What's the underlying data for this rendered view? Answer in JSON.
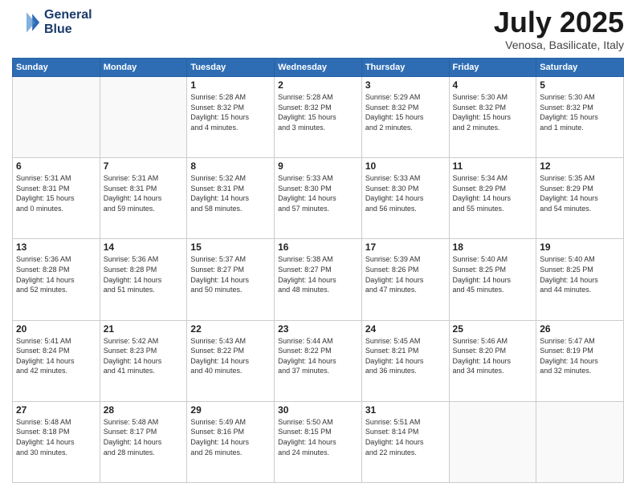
{
  "header": {
    "logo_line1": "General",
    "logo_line2": "Blue",
    "month": "July 2025",
    "location": "Venosa, Basilicate, Italy"
  },
  "weekdays": [
    "Sunday",
    "Monday",
    "Tuesday",
    "Wednesday",
    "Thursday",
    "Friday",
    "Saturday"
  ],
  "weeks": [
    [
      {
        "day": "",
        "text": ""
      },
      {
        "day": "",
        "text": ""
      },
      {
        "day": "1",
        "text": "Sunrise: 5:28 AM\nSunset: 8:32 PM\nDaylight: 15 hours\nand 4 minutes."
      },
      {
        "day": "2",
        "text": "Sunrise: 5:28 AM\nSunset: 8:32 PM\nDaylight: 15 hours\nand 3 minutes."
      },
      {
        "day": "3",
        "text": "Sunrise: 5:29 AM\nSunset: 8:32 PM\nDaylight: 15 hours\nand 2 minutes."
      },
      {
        "day": "4",
        "text": "Sunrise: 5:30 AM\nSunset: 8:32 PM\nDaylight: 15 hours\nand 2 minutes."
      },
      {
        "day": "5",
        "text": "Sunrise: 5:30 AM\nSunset: 8:32 PM\nDaylight: 15 hours\nand 1 minute."
      }
    ],
    [
      {
        "day": "6",
        "text": "Sunrise: 5:31 AM\nSunset: 8:31 PM\nDaylight: 15 hours\nand 0 minutes."
      },
      {
        "day": "7",
        "text": "Sunrise: 5:31 AM\nSunset: 8:31 PM\nDaylight: 14 hours\nand 59 minutes."
      },
      {
        "day": "8",
        "text": "Sunrise: 5:32 AM\nSunset: 8:31 PM\nDaylight: 14 hours\nand 58 minutes."
      },
      {
        "day": "9",
        "text": "Sunrise: 5:33 AM\nSunset: 8:30 PM\nDaylight: 14 hours\nand 57 minutes."
      },
      {
        "day": "10",
        "text": "Sunrise: 5:33 AM\nSunset: 8:30 PM\nDaylight: 14 hours\nand 56 minutes."
      },
      {
        "day": "11",
        "text": "Sunrise: 5:34 AM\nSunset: 8:29 PM\nDaylight: 14 hours\nand 55 minutes."
      },
      {
        "day": "12",
        "text": "Sunrise: 5:35 AM\nSunset: 8:29 PM\nDaylight: 14 hours\nand 54 minutes."
      }
    ],
    [
      {
        "day": "13",
        "text": "Sunrise: 5:36 AM\nSunset: 8:28 PM\nDaylight: 14 hours\nand 52 minutes."
      },
      {
        "day": "14",
        "text": "Sunrise: 5:36 AM\nSunset: 8:28 PM\nDaylight: 14 hours\nand 51 minutes."
      },
      {
        "day": "15",
        "text": "Sunrise: 5:37 AM\nSunset: 8:27 PM\nDaylight: 14 hours\nand 50 minutes."
      },
      {
        "day": "16",
        "text": "Sunrise: 5:38 AM\nSunset: 8:27 PM\nDaylight: 14 hours\nand 48 minutes."
      },
      {
        "day": "17",
        "text": "Sunrise: 5:39 AM\nSunset: 8:26 PM\nDaylight: 14 hours\nand 47 minutes."
      },
      {
        "day": "18",
        "text": "Sunrise: 5:40 AM\nSunset: 8:25 PM\nDaylight: 14 hours\nand 45 minutes."
      },
      {
        "day": "19",
        "text": "Sunrise: 5:40 AM\nSunset: 8:25 PM\nDaylight: 14 hours\nand 44 minutes."
      }
    ],
    [
      {
        "day": "20",
        "text": "Sunrise: 5:41 AM\nSunset: 8:24 PM\nDaylight: 14 hours\nand 42 minutes."
      },
      {
        "day": "21",
        "text": "Sunrise: 5:42 AM\nSunset: 8:23 PM\nDaylight: 14 hours\nand 41 minutes."
      },
      {
        "day": "22",
        "text": "Sunrise: 5:43 AM\nSunset: 8:22 PM\nDaylight: 14 hours\nand 40 minutes."
      },
      {
        "day": "23",
        "text": "Sunrise: 5:44 AM\nSunset: 8:22 PM\nDaylight: 14 hours\nand 37 minutes."
      },
      {
        "day": "24",
        "text": "Sunrise: 5:45 AM\nSunset: 8:21 PM\nDaylight: 14 hours\nand 36 minutes."
      },
      {
        "day": "25",
        "text": "Sunrise: 5:46 AM\nSunset: 8:20 PM\nDaylight: 14 hours\nand 34 minutes."
      },
      {
        "day": "26",
        "text": "Sunrise: 5:47 AM\nSunset: 8:19 PM\nDaylight: 14 hours\nand 32 minutes."
      }
    ],
    [
      {
        "day": "27",
        "text": "Sunrise: 5:48 AM\nSunset: 8:18 PM\nDaylight: 14 hours\nand 30 minutes."
      },
      {
        "day": "28",
        "text": "Sunrise: 5:48 AM\nSunset: 8:17 PM\nDaylight: 14 hours\nand 28 minutes."
      },
      {
        "day": "29",
        "text": "Sunrise: 5:49 AM\nSunset: 8:16 PM\nDaylight: 14 hours\nand 26 minutes."
      },
      {
        "day": "30",
        "text": "Sunrise: 5:50 AM\nSunset: 8:15 PM\nDaylight: 14 hours\nand 24 minutes."
      },
      {
        "day": "31",
        "text": "Sunrise: 5:51 AM\nSunset: 8:14 PM\nDaylight: 14 hours\nand 22 minutes."
      },
      {
        "day": "",
        "text": ""
      },
      {
        "day": "",
        "text": ""
      }
    ]
  ]
}
